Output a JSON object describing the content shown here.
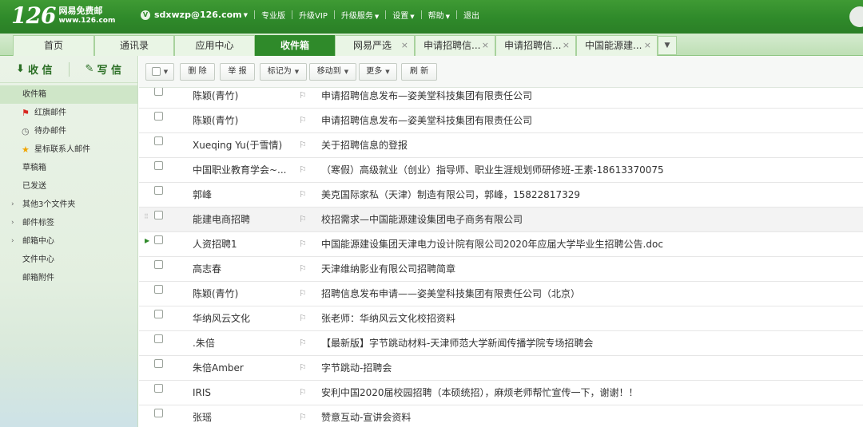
{
  "brand": {
    "logo_number": "126",
    "logo_name": "网易免费邮",
    "logo_url": "www.126.com"
  },
  "topnav": {
    "account": "sdxwzp@126.com",
    "badge": "V",
    "links": [
      "专业版",
      "升级VIP",
      "升级服务",
      "设置",
      "帮助",
      "退出"
    ]
  },
  "tabs": {
    "home": "首页",
    "contacts": "通讯录",
    "apps": "应用中心",
    "inbox": "收件箱",
    "yanxuan": "网易严选",
    "mail1": "申请招聘信...",
    "mail2": "申请招聘信...",
    "mail3": "中国能源建..."
  },
  "sidebar": {
    "receive": "收 信",
    "compose": "写 信",
    "folders": {
      "inbox": "收件箱",
      "flagged": "红旗邮件",
      "todo": "待办邮件",
      "starred": "星标联系人邮件",
      "drafts": "草稿箱",
      "sent": "已发送",
      "others": "其他3个文件夹",
      "tags": "邮件标签",
      "mailcenter": "邮箱中心",
      "files": "文件中心",
      "attachments": "邮箱附件"
    }
  },
  "toolbar": {
    "delete": "删 除",
    "report": "举 报",
    "mark": "标记为",
    "move": "移动到",
    "more": "更多",
    "refresh": "刷 新"
  },
  "mails": [
    {
      "sender": "陈颖(青竹)",
      "subject": "申请招聘信息发布—姿美堂科技集团有限责任公司"
    },
    {
      "sender": "陈颖(青竹)",
      "subject": "申请招聘信息发布—姿美堂科技集团有限责任公司"
    },
    {
      "sender": "Xueqing Yu(于雪情)",
      "subject": "关于招聘信息的登报"
    },
    {
      "sender": "中国职业教育学会~...",
      "subject": "（寒假）高级就业（创业）指导师、职业生涯规划师研修班-王素-18613370075"
    },
    {
      "sender": "郭峰",
      "subject": "美克国际家私（天津）制造有限公司，郭峰，15822817329"
    },
    {
      "sender": "能建电商招聘",
      "subject": "校招需求—中国能源建设集团电子商务有限公司"
    },
    {
      "sender": "人资招聘1",
      "subject": "中国能源建设集团天津电力设计院有限公司2020年应届大学毕业生招聘公告.doc"
    },
    {
      "sender": "高志春",
      "subject": "天津维纳影业有限公司招聘简章"
    },
    {
      "sender": "陈颖(青竹)",
      "subject": "招聘信息发布申请——姿美堂科技集团有限责任公司（北京）"
    },
    {
      "sender": "华纳风云文化",
      "subject": "张老师：华纳风云文化校招资料"
    },
    {
      "sender": ".朱倍",
      "subject": "【最新版】字节跳动材料-天津师范大学新闻传播学院专场招聘会"
    },
    {
      "sender": "朱倍Amber",
      "subject": "字节跳动-招聘会"
    },
    {
      "sender": "IRIS",
      "subject": "安利中国2020届校园招聘（本硕统招），麻烦老师帮忙宣传一下，谢谢！！"
    },
    {
      "sender": "张瑶",
      "subject": "赞意互动-宣讲会资料"
    }
  ]
}
